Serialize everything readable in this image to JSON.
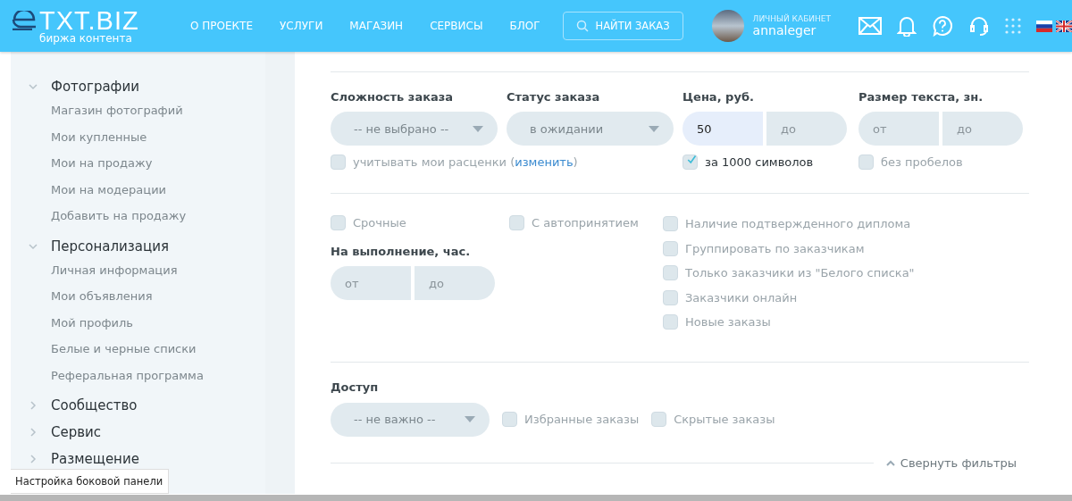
{
  "header": {
    "logo": {
      "brand": "TXT.BIZ",
      "tagline": "биржа контента"
    },
    "nav": [
      "О ПРОЕКТЕ",
      "УСЛУГИ",
      "МАГАЗИН",
      "СЕРВИСЫ",
      "БЛОГ"
    ],
    "find_button": "НАЙТИ ЗАКАЗ",
    "user": {
      "caption": "ЛИЧНЫЙ КАБИНЕТ",
      "name": "annaleger"
    }
  },
  "sidebar": {
    "groups": [
      {
        "label": "Фотографии",
        "expanded": true,
        "children": [
          {
            "label": "Магазин фотографий"
          },
          {
            "label": "Мои купленные"
          },
          {
            "label": "Мои на продажу"
          },
          {
            "label": "Мои на модерации"
          },
          {
            "label": "Добавить на продажу"
          }
        ]
      },
      {
        "label": "Персонализация",
        "expanded": true,
        "children": [
          {
            "label": "Личная информация"
          },
          {
            "label": "Мои объявления"
          },
          {
            "label": "Мой профиль"
          },
          {
            "label": "Белые и черные списки"
          },
          {
            "label": "Реферальная программа"
          }
        ]
      },
      {
        "label": "Сообщество",
        "expanded": false
      },
      {
        "label": "Сервис",
        "expanded": false
      },
      {
        "label": "Размещение",
        "expanded": false
      }
    ],
    "tooltip": "Настройка боковой панели"
  },
  "filters": {
    "row1": [
      {
        "label": "Сложность заказа",
        "kind": "select",
        "value": "-- не выбрано --",
        "checkbox": {
          "text": "учитывать мои расценки (",
          "link": "изменить",
          "suffix": ")",
          "checked": false
        }
      },
      {
        "label": "Статус заказа",
        "kind": "select",
        "value": "в ожидании"
      },
      {
        "label": "Цена, руб.",
        "kind": "range",
        "from": {
          "value": "50"
        },
        "to": {
          "placeholder": "до"
        },
        "checkbox": {
          "text": "за 1000 символов",
          "checked": true
        }
      },
      {
        "label": "Размер текста, зн.",
        "kind": "range",
        "from": {
          "placeholder": "от"
        },
        "to": {
          "placeholder": "до"
        },
        "checkbox": {
          "text": "без пробелов",
          "checked": false
        }
      }
    ],
    "urgent": {
      "text": "Срочные",
      "checked": false
    },
    "auto_accept": {
      "text": "С автопринятием",
      "checked": false
    },
    "deadline": {
      "label": "На выполнение, час.",
      "from": {
        "placeholder": "от"
      },
      "to": {
        "placeholder": "до"
      }
    },
    "options": [
      {
        "text": "Наличие подтвержденного диплома",
        "checked": false
      },
      {
        "text": "Группировать по заказчикам",
        "checked": false
      },
      {
        "text": "Только заказчики из \"Белого списка\"",
        "checked": false
      },
      {
        "text": "Заказчики онлайн",
        "checked": false
      },
      {
        "text": "Новые заказы",
        "checked": false
      }
    ],
    "access": {
      "label": "Доступ",
      "value": "-- не важно --",
      "options": [
        {
          "text": "Избранные заказы",
          "checked": false
        },
        {
          "text": "Скрытые заказы",
          "checked": false
        }
      ]
    },
    "collapse": "Свернуть фильтры"
  }
}
